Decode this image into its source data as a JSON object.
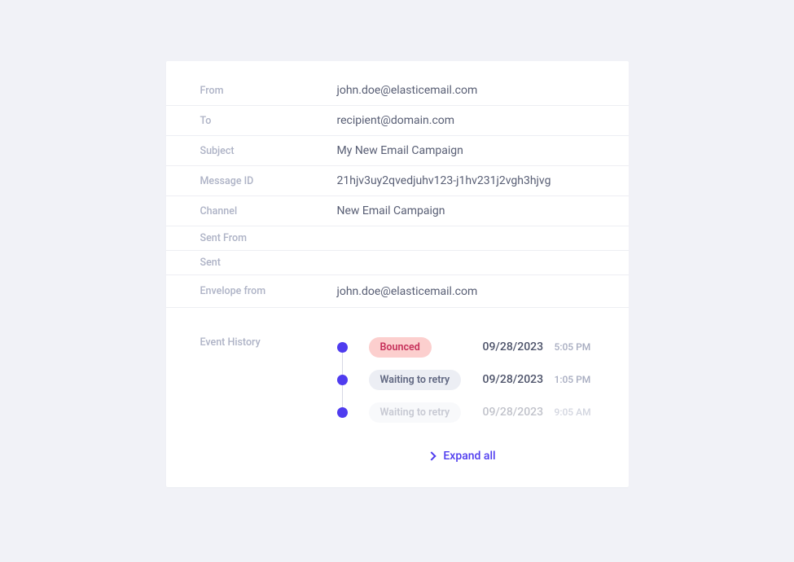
{
  "details": {
    "from_label": "From",
    "from_value": "john.doe@elasticemail.com",
    "to_label": "To",
    "to_value": "recipient@domain.com",
    "subject_label": "Subject",
    "subject_value": "My New Email Campaign",
    "messageid_label": "Message ID",
    "messageid_value": "21hjv3uy2qvedjuhv123-j1hv231j2vgh3hjvg",
    "channel_label": "Channel",
    "channel_value": "New Email Campaign",
    "sentfrom_label": "Sent From",
    "sentfrom_value": "",
    "sent_label": "Sent",
    "sent_value": "",
    "envelope_label": "Envelope from",
    "envelope_value": "john.doe@elasticemail.com"
  },
  "history": {
    "label": "Event History",
    "events": [
      {
        "status": "Bounced",
        "badge_class": "bounced",
        "date": "09/28/2023",
        "time": "5:05 PM",
        "faded": false
      },
      {
        "status": "Waiting to retry",
        "badge_class": "waiting",
        "date": "09/28/2023",
        "time": "1:05 PM",
        "faded": false
      },
      {
        "status": "Waiting to retry",
        "badge_class": "waiting",
        "date": "09/28/2023",
        "time": "9:05 AM",
        "faded": true
      }
    ],
    "expand_label": "Expand all"
  }
}
